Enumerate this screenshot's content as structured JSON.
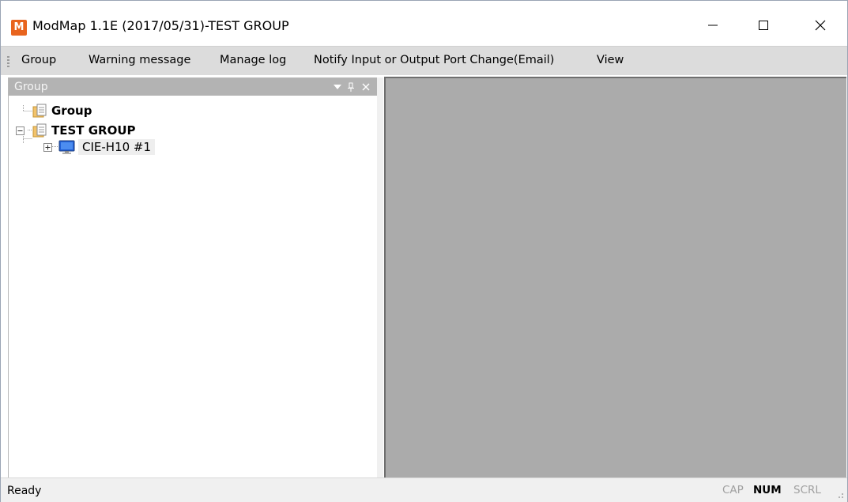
{
  "window": {
    "title": "ModMap 1.1E (2017/05/31)-TEST GROUP",
    "app_icon_letter": "M",
    "accent": "#e8641e"
  },
  "menu": {
    "items": [
      {
        "label": "Group"
      },
      {
        "label": "Warning message"
      },
      {
        "label": "Manage log"
      },
      {
        "label": "Notify Input or Output Port Change(Email)"
      },
      {
        "label": "View"
      }
    ]
  },
  "group_pane": {
    "title": "Group",
    "tree": [
      {
        "label": "Group",
        "icon": "folder-document-icon"
      },
      {
        "label": "TEST GROUP",
        "icon": "folder-document-icon",
        "expanded": true,
        "children": [
          {
            "label": "CIE-H10 #1",
            "icon": "monitor-icon",
            "selected": true
          }
        ]
      }
    ]
  },
  "status": {
    "text": "Ready",
    "indicators": [
      {
        "label": "CAP",
        "active": false
      },
      {
        "label": "NUM",
        "active": true
      },
      {
        "label": "SCRL",
        "active": false
      }
    ]
  }
}
